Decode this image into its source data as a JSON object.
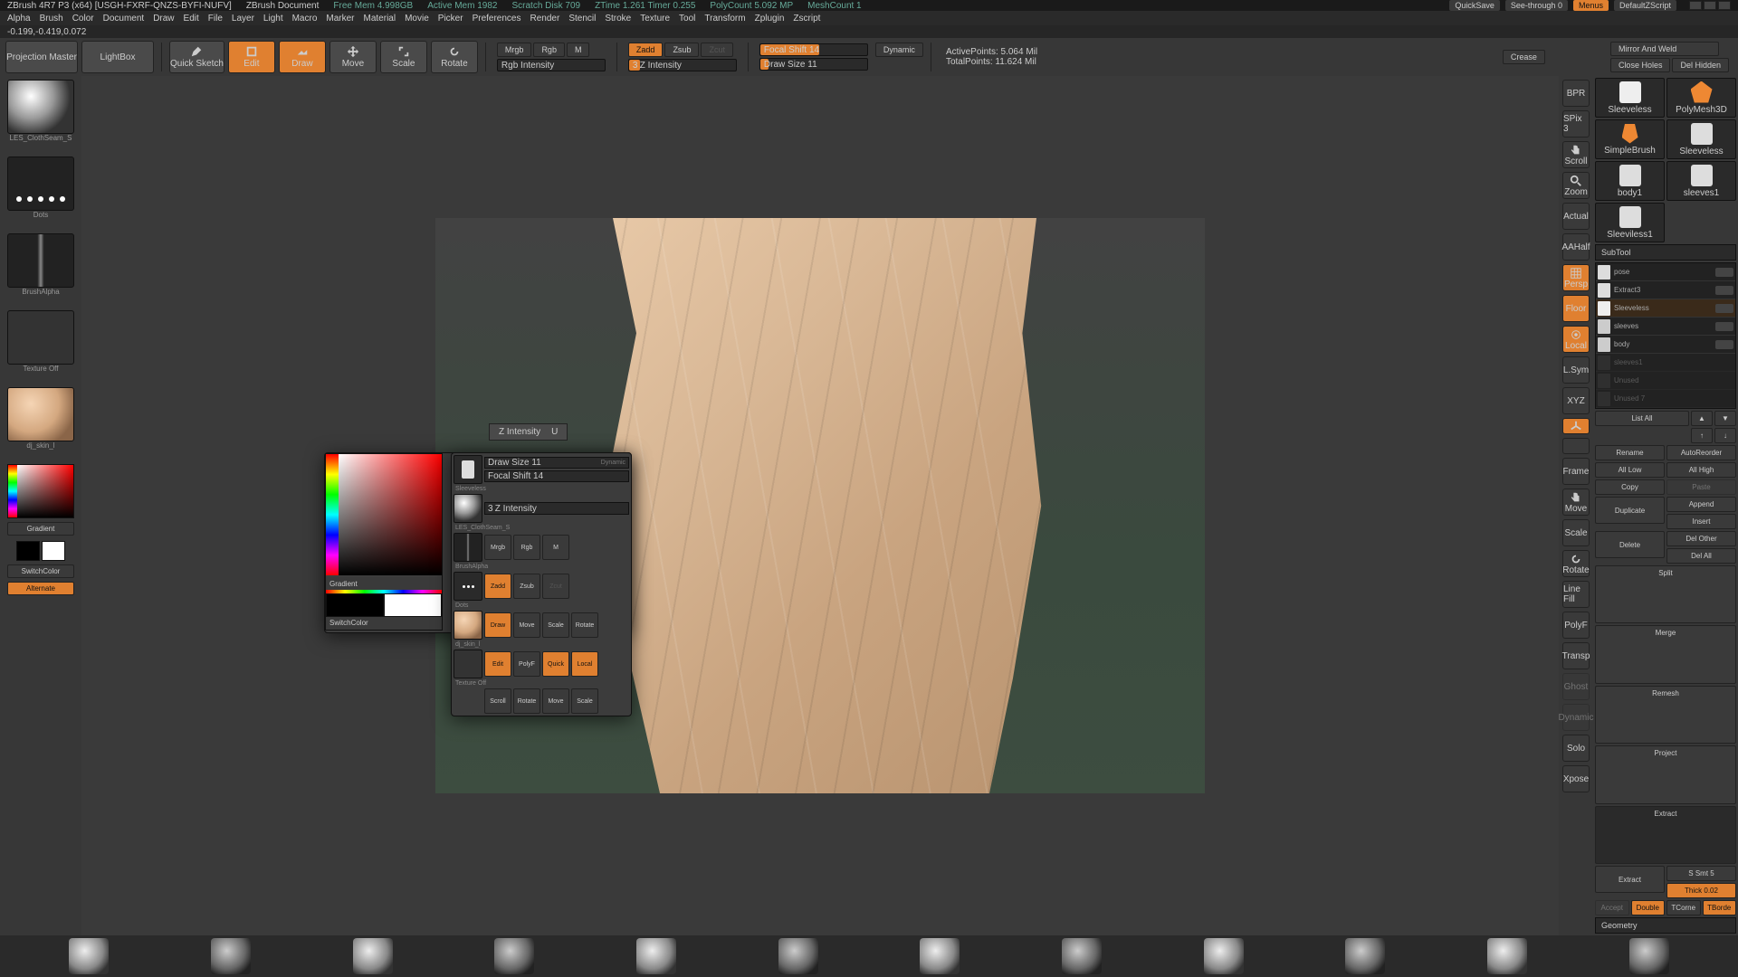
{
  "titlebar": {
    "app": "ZBrush 4R7 P3 (x64) [USGH-FXRF-QNZS-BYFI-NUFV]",
    "doc": "ZBrush Document",
    "freemem": "Free Mem 4.998GB",
    "activemem": "Active Mem 1982",
    "scratch": "Scratch Disk 709",
    "ztime": "ZTime 1.261 Timer 0.255",
    "polycount": "PolyCount 5.092 MP",
    "meshcount": "MeshCount 1",
    "quicksave": "QuickSave",
    "seethrough": "See-through  0",
    "menus": "Menus",
    "defscript": "DefaultZScript"
  },
  "menus": [
    "Alpha",
    "Brush",
    "Color",
    "Document",
    "Draw",
    "Edit",
    "File",
    "Layer",
    "Light",
    "Macro",
    "Marker",
    "Material",
    "Movie",
    "Picker",
    "Preferences",
    "Render",
    "Stencil",
    "Stroke",
    "Texture",
    "Tool",
    "Transform",
    "Zplugin",
    "Zscript"
  ],
  "coords": "-0.199,-0.419,0.072",
  "shelf": {
    "projmaster": "Projection Master",
    "lightbox": "LightBox",
    "quicksketch": "Quick Sketch",
    "edit": "Edit",
    "draw": "Draw",
    "move": "Move",
    "scale": "Scale",
    "rotate": "Rotate",
    "mrgb": "Mrgb",
    "rgb": "Rgb",
    "m": "M",
    "rgbint": "Rgb Intensity",
    "zadd": "Zadd",
    "zsub": "Zsub",
    "zcut": "Zcut",
    "zint_val": "3",
    "zint": "Z Intensity",
    "focal": "Focal Shift 14",
    "drawsize": "Draw Size 11",
    "dynamic": "Dynamic",
    "activepts": "ActivePoints: 5.064 Mil",
    "totalpts": "TotalPoints: 11.624 Mil",
    "crease": "Crease",
    "mirror": "Mirror And Weld",
    "closeholes": "Close Holes",
    "delhidden": "Del Hidden"
  },
  "left": {
    "mat": "LES_ClothSeam_S",
    "dots": "Dots",
    "brushalpha": "BrushAlpha",
    "texoff": "Texture Off",
    "skin": "dj_skin_l",
    "gradient": "Gradient",
    "switchcolor": "SwitchColor",
    "alternate": "Alternate"
  },
  "tooltip": {
    "label": "Z Intensity",
    "key": "U"
  },
  "popup": {
    "sleeveless": "Sleeveless",
    "clothseam": "LES_ClothSeam_S",
    "brushalpha": "BrushAlpha",
    "dots": "Dots",
    "skin": "dj_skin_l",
    "texoff": "Texture Off",
    "drawsize": "Draw Size 11",
    "focal": "Focal Shift 14",
    "zint": "Z Intensity",
    "zint_val": "3",
    "dynamic": "Dynamic",
    "mrgb": "Mrgb",
    "rgb": "Rgb",
    "m": "M",
    "zadd": "Zadd",
    "zsub": "Zsub",
    "zcut": "Zcut",
    "draw": "Draw",
    "move": "Move",
    "scale": "Scale",
    "rotate": "Rotate",
    "edit": "Edit",
    "poly": "PolyF",
    "quick": "Quick",
    "local": "Local",
    "scroll": "Scroll",
    "rotate2": "Rotate",
    "move2": "Move",
    "scale2": "Scale",
    "gradient": "Gradient",
    "switchcolor": "SwitchColor"
  },
  "rightbtns": {
    "bpr": "BPR",
    "spix": "SPix 3",
    "scroll": "Scroll",
    "zoom": "Zoom",
    "actual": "Actual",
    "aahalf": "AAHalf",
    "persp": "Persp",
    "floor": "Floor",
    "local": "Local",
    "lsym": "L.Sym",
    "xyz": "XYZ",
    "frame": "Frame",
    "move": "Move",
    "scale": "Scale",
    "rotate": "Rotate",
    "linefill": "Line Fill",
    "polyf": "PolyF",
    "transp": "Transp",
    "ghost": "Ghost",
    "dynamic": "Dynamic",
    "solo": "Solo",
    "xpose": "Xpose"
  },
  "tools": {
    "row1": [
      "Sleeveless",
      "PolyMesh3D"
    ],
    "row2": [
      "SimpleBrush",
      "Sleeveless"
    ],
    "row3": [
      "body1",
      "sleeves1"
    ],
    "row4": [
      "Sleeviless1",
      ""
    ]
  },
  "subtool": {
    "hdr": "SubTool",
    "items": [
      {
        "name": "pose"
      },
      {
        "name": "Extract3"
      },
      {
        "name": "Sleeveless"
      },
      {
        "name": "sleeves"
      },
      {
        "name": "body"
      },
      {
        "name": "sleeves1"
      },
      {
        "name": "Unused"
      },
      {
        "name": "Unused 7"
      }
    ],
    "listall": "List All",
    "rename": "Rename",
    "autoreorder": "AutoReorder",
    "alllow": "All Low",
    "allhigh": "All High",
    "copy": "Copy",
    "paste": "Paste",
    "duplicate": "Duplicate",
    "append": "Append",
    "insert": "Insert",
    "delete": "Delete",
    "delother": "Del Other",
    "delall": "Del All",
    "split": "Split",
    "merge": "Merge",
    "remesh": "Remesh",
    "project": "Project",
    "extract": "Extract",
    "ext_btn": "Extract",
    "smt": "S Smt 5",
    "thick": "Thick 0.02",
    "accept": "Accept",
    "double": "Double",
    "tcorne": "TCorne",
    "tborde": "TBorde",
    "geometry": "Geometry"
  }
}
